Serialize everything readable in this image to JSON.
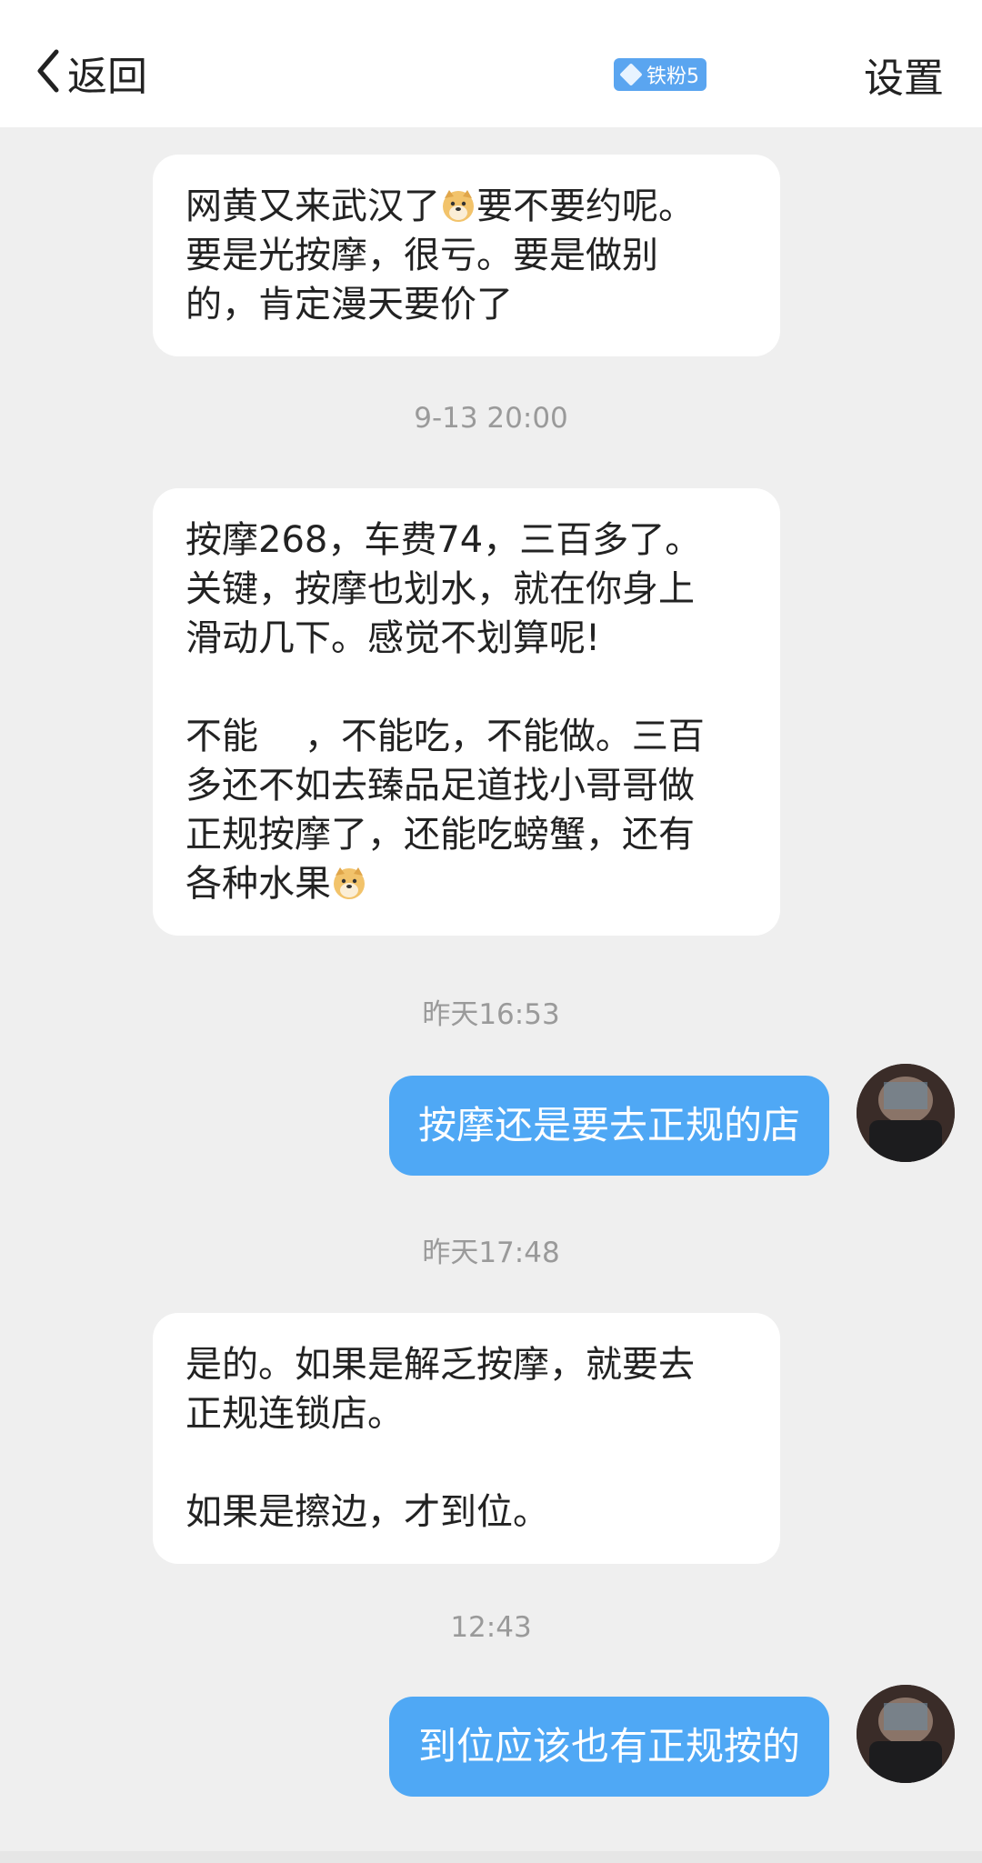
{
  "header": {
    "back_label": "返回",
    "fan_badge": "铁粉5",
    "settings_label": "设置"
  },
  "messages": {
    "m1": {
      "a": "网黄又来武汉了",
      "b": "要不要约呢。\n要是光按摩，很亏。要是做别\n的，肯定漫天要价了"
    },
    "t1": "9-13 20:00",
    "m2": {
      "a": "按摩268，车费74，三百多了。\n关键，按摩也划水，就在你身上\n滑动几下。感觉不划算呢!\n\n不能    ，不能吃，不能做。三百\n多还不如去臻品足道找小哥哥做\n正规按摩了，还能吃螃蟹，还有\n各种水果"
    },
    "t2": "昨天16:53",
    "m3": "按摩还是要去正规的店",
    "t3": "昨天17:48",
    "m4": "是的。如果是解乏按摩，就要去\n正规连锁店。\n\n如果是擦边，才到位。",
    "t4": "12:43",
    "m5": "到位应该也有正规按的"
  },
  "icons": {
    "back": "chevron-left-icon",
    "emoji": "doge-emoji-icon",
    "avatar": "user-avatar"
  },
  "colors": {
    "outgoing_bubble": "#4fa8f5",
    "incoming_bubble": "#ffffff",
    "background": "#efefef",
    "badge": "#5aa5f0"
  }
}
